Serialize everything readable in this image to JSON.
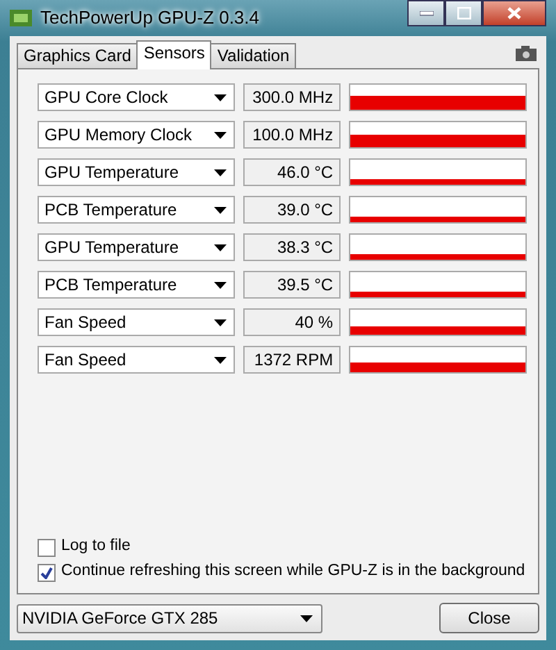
{
  "window": {
    "title": "TechPowerUp GPU-Z 0.3.4"
  },
  "tabs": [
    {
      "label": "Graphics Card",
      "selected": false
    },
    {
      "label": "Sensors",
      "selected": true
    },
    {
      "label": "Validation",
      "selected": false
    }
  ],
  "sensors": [
    {
      "name": "GPU Core Clock",
      "reading": "300.0 MHz"
    },
    {
      "name": "GPU Memory Clock",
      "reading": "100.0 MHz"
    },
    {
      "name": "GPU Temperature",
      "reading": "46.0 °C"
    },
    {
      "name": "PCB Temperature",
      "reading": "39.0 °C"
    },
    {
      "name": "GPU Temperature",
      "reading": "38.3 °C"
    },
    {
      "name": "PCB Temperature",
      "reading": "39.5 °C"
    },
    {
      "name": "Fan Speed",
      "reading": "40 %"
    },
    {
      "name": "Fan Speed",
      "reading": "1372 RPM"
    }
  ],
  "options": [
    {
      "label": "Log to file",
      "checked": false
    },
    {
      "label": "Continue refreshing this screen while GPU-Z is in the background",
      "checked": true
    }
  ],
  "card_select": {
    "value": "NVIDIA GeForce GTX 285"
  },
  "buttons": [
    "Close"
  ]
}
